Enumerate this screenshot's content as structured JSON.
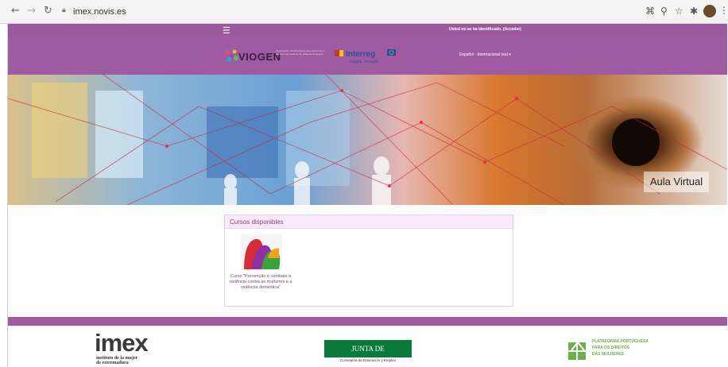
{
  "browser": {
    "url": "imex.novis.es",
    "icons": [
      "back-icon",
      "forward-icon",
      "reload-icon",
      "lock-icon",
      "extensions-grid-icon",
      "zoom-icon",
      "star-icon",
      "puzzle-icon",
      "avatar",
      "menu-dots-icon"
    ]
  },
  "topbar": {
    "login_text": "Usted no se ha identificado. (Acceder)",
    "menu_icon": "hamburger-icon"
  },
  "header": {
    "viogen_name": "VIOGEN",
    "viogen_tagline": "Cooperación transfronteriza para reducir de la atención del contexto de violencia de género",
    "interreg_name": "Interreg",
    "interreg_sub": "España - Portugal",
    "language": "Español - Internacional (es) ▾"
  },
  "hero": {
    "title": "Aula Virtual"
  },
  "courses": {
    "heading": "Cursos disponibles",
    "items": [
      {
        "title": "Curso \"Prevenção e combate à violência contra as mulheres e a violência doméstica\""
      }
    ]
  },
  "footer": {
    "imex_word": "imex",
    "imex_sub_line1": "instituto de la mujer",
    "imex_sub_line2": "de extremadura",
    "junta_name": "JUNTA DE EXTREMADURA",
    "junta_sub": "Consejería de Educación y Empleo",
    "ppdm_line1": "PLATAFORMA PORTUGUESA",
    "ppdm_line2": "PARA OS DIREITOS",
    "ppdm_line3": "DAS MULHERES"
  },
  "colors": {
    "brand_purple": "#9e5ba1",
    "junta_green": "#0a7a3a",
    "ppdm_green": "#6ab04c"
  }
}
